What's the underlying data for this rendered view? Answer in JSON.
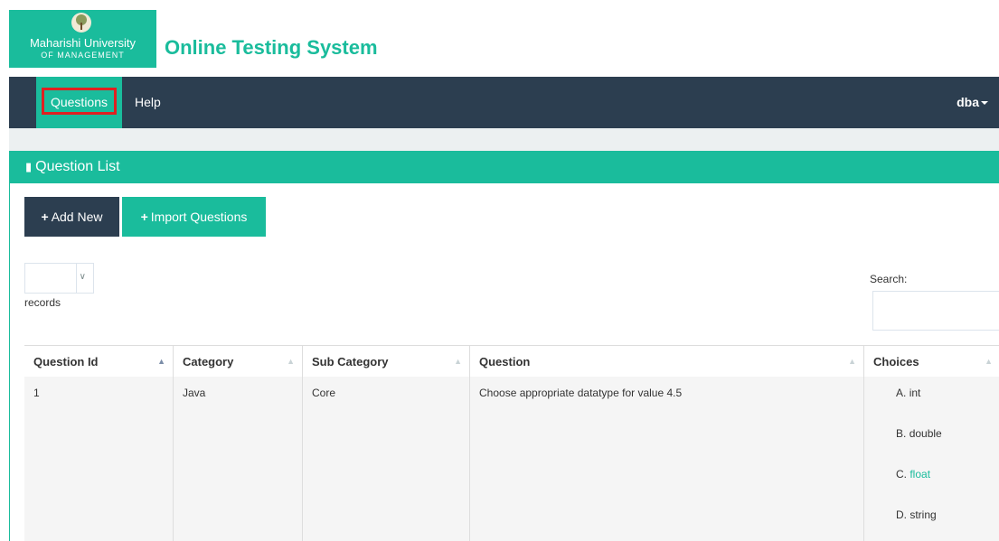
{
  "header": {
    "logo": {
      "line1": "Maharishi University",
      "line2": "OF MANAGEMENT"
    },
    "app_title": "Online Testing System"
  },
  "navbar": {
    "items": [
      {
        "label": "Questions",
        "active": true,
        "highlighted": true
      },
      {
        "label": "Help",
        "active": false
      }
    ],
    "user": {
      "label": "dba"
    }
  },
  "panel": {
    "title": "Question List",
    "icon": "book-icon",
    "buttons": {
      "add_new": "Add New",
      "import": "Import Questions"
    },
    "length": {
      "label": "records",
      "selected": ""
    },
    "search": {
      "label": "Search:",
      "value": ""
    }
  },
  "table": {
    "columns": [
      "Question Id",
      "Category",
      "Sub Category",
      "Question",
      "Choices"
    ],
    "sorted_column": "Question Id",
    "rows": [
      {
        "id": "1",
        "category": "Java",
        "sub_category": "Core",
        "question": "Choose appropriate datatype for value 4.5",
        "choices": [
          {
            "prefix": "A.",
            "text": "int",
            "correct": false
          },
          {
            "prefix": "B.",
            "text": "double",
            "correct": false
          },
          {
            "prefix": "C.",
            "text": "float",
            "correct": true
          },
          {
            "prefix": "D.",
            "text": "string",
            "correct": false
          }
        ]
      }
    ]
  },
  "colors": {
    "accent": "#1abc9c",
    "navbar": "#2c3e50",
    "highlight": "#e02020"
  }
}
